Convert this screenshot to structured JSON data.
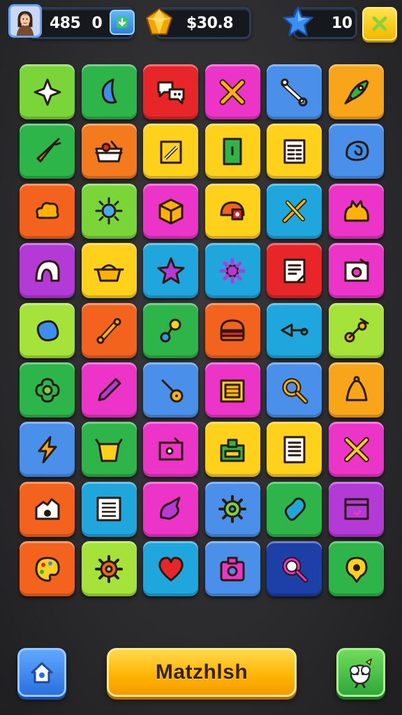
{
  "hud": {
    "coins": "485",
    "coin_sub": "0",
    "gems": "$30.8",
    "stars": "10"
  },
  "board": {
    "tiles": [
      {
        "color": "#7ad638",
        "icon": "sparkle-icon"
      },
      {
        "color": "#2db54a",
        "icon": "leaf-icon"
      },
      {
        "color": "#e8262a",
        "icon": "chat-bubbles-icon"
      },
      {
        "color": "#ec35c8",
        "icon": "cross-icon"
      },
      {
        "color": "#4a90ea",
        "icon": "wrench-icon"
      },
      {
        "color": "#f9a51a",
        "icon": "rocket-icon"
      },
      {
        "color": "#2db54a",
        "icon": "carrot-icon"
      },
      {
        "color": "#f47a1e",
        "icon": "basket-icon"
      },
      {
        "color": "#ffd11a",
        "icon": "notepad-icon"
      },
      {
        "color": "#ffd11a",
        "icon": "door-icon"
      },
      {
        "color": "#ffd11a",
        "icon": "calendar-icon"
      },
      {
        "color": "#4a90ea",
        "icon": "snail-icon"
      },
      {
        "color": "#f4631e",
        "icon": "cloud-icon"
      },
      {
        "color": "#7ad638",
        "icon": "sun-icon"
      },
      {
        "color": "#ec35c8",
        "icon": "box-icon"
      },
      {
        "color": "#ffd11a",
        "icon": "helmet-icon"
      },
      {
        "color": "#1fa6dc",
        "icon": "tools-icon"
      },
      {
        "color": "#ec35c8",
        "icon": "cat-icon"
      },
      {
        "color": "#b43ad8",
        "icon": "arch-icon"
      },
      {
        "color": "#ffd11a",
        "icon": "pot-icon"
      },
      {
        "color": "#1fa6dc",
        "icon": "star-icon"
      },
      {
        "color": "#1fa6dc",
        "icon": "gear-flower-icon"
      },
      {
        "color": "#e8262a",
        "icon": "document-icon"
      },
      {
        "color": "#ec35c8",
        "icon": "photo-icon"
      },
      {
        "color": "#a6e33a",
        "icon": "blob-icon"
      },
      {
        "color": "#f4631e",
        "icon": "bone-icon"
      },
      {
        "color": "#2db54a",
        "icon": "molecule-icon"
      },
      {
        "color": "#f4631e",
        "icon": "burger-icon"
      },
      {
        "color": "#1fa6dc",
        "icon": "key-icon"
      },
      {
        "color": "#a6e33a",
        "icon": "scooter-icon"
      },
      {
        "color": "#2db54a",
        "icon": "flower-icon"
      },
      {
        "color": "#ec35c8",
        "icon": "pen-icon"
      },
      {
        "color": "#4a90ea",
        "icon": "guitar-icon"
      },
      {
        "color": "#ec35c8",
        "icon": "window-icon"
      },
      {
        "color": "#4a90ea",
        "icon": "magnifier-icon"
      },
      {
        "color": "#f9a51a",
        "icon": "bell-icon"
      },
      {
        "color": "#4a90ea",
        "icon": "lightning-icon"
      },
      {
        "color": "#2db54a",
        "icon": "bag-icon"
      },
      {
        "color": "#ec35c8",
        "icon": "tv-icon"
      },
      {
        "color": "#ffd11a",
        "icon": "lunchbox-icon"
      },
      {
        "color": "#ffd11a",
        "icon": "list-icon"
      },
      {
        "color": "#ec35c8",
        "icon": "crossed-tools-icon"
      },
      {
        "color": "#f4631e",
        "icon": "camera-house-icon"
      },
      {
        "color": "#1fa6dc",
        "icon": "table-icon"
      },
      {
        "color": "#ec35c8",
        "icon": "bird-icon"
      },
      {
        "color": "#4a90ea",
        "icon": "cog-icon"
      },
      {
        "color": "#2db54a",
        "icon": "bean-icon"
      },
      {
        "color": "#b43ad8",
        "icon": "browser-icon"
      },
      {
        "color": "#f4631e",
        "icon": "palette-icon"
      },
      {
        "color": "#a6e33a",
        "icon": "gear-icon"
      },
      {
        "color": "#1fa6dc",
        "icon": "heart-icon"
      },
      {
        "color": "#4a90ea",
        "icon": "camera-icon"
      },
      {
        "color": "#1c3fa8",
        "icon": "search-icon"
      },
      {
        "color": "#2db54a",
        "icon": "location-icon"
      }
    ]
  },
  "footer": {
    "match_label": "Matzhlsh"
  },
  "colors": {
    "board_bg": "#2b2b2d",
    "match_button": "#ffb300"
  }
}
